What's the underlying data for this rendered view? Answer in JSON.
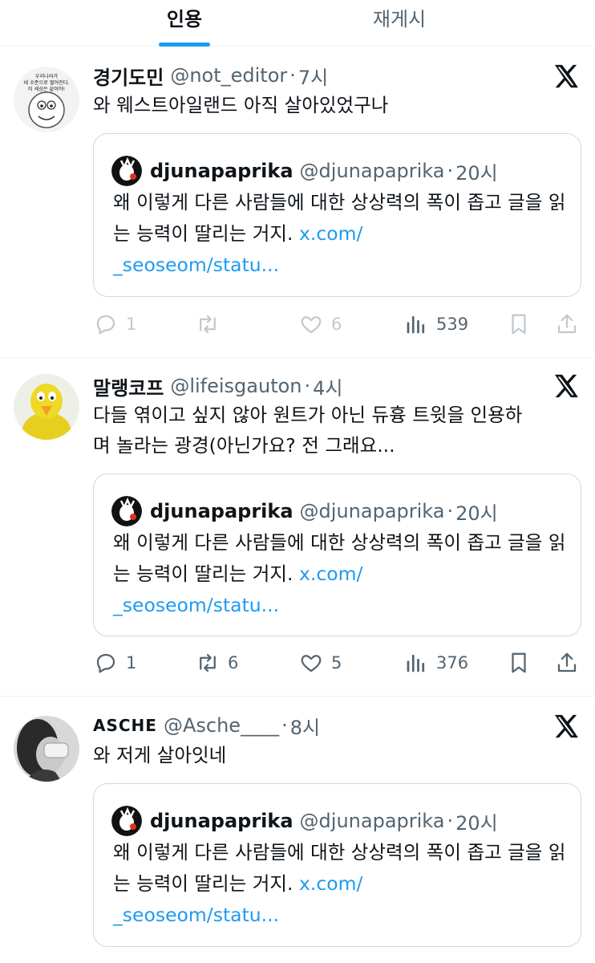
{
  "tabs": {
    "quote": "인용",
    "repost": "재게시"
  },
  "quoted_tweet": {
    "name": "djunapaprika",
    "handle": "@djunapaprika",
    "time": "20시",
    "text": "왜 이렇게 다른 사람들에 대한 상상력의 폭이 좁고 글을 읽는 능력이 딸리는 거지.",
    "link_line1": "x.com/",
    "link_line2": "_seoseom/statu..."
  },
  "tweets": [
    {
      "name": "경기도민",
      "handle": "@not_editor",
      "time": "7시",
      "text": "와 웨스트아일랜드 아직 살아있었구나",
      "replies": "1",
      "reposts": "",
      "likes": "6",
      "views": "539",
      "avatar_caption_line1": "우리나라가",
      "avatar_caption_line2": "네 수준으로 떨어진다.",
      "avatar_caption_line3": "이 세상은 끝이야!"
    },
    {
      "name": "말랭코프",
      "handle": "@lifeisgauton",
      "time": "4시",
      "text_line1": "다들 엮이고 싶지 않아 원트가 아닌 듀흉 트윗을 인용하",
      "text_line2": "며 놀라는 광경(아닌가요? 전 그래요...",
      "replies": "1",
      "reposts": "6",
      "likes": "5",
      "views": "376"
    },
    {
      "name": "ASCHE",
      "handle": "@Asche____",
      "time": "8시",
      "text": "와 저게 살아잇네"
    }
  ],
  "separator": "·",
  "colors": {
    "accent": "#1d9bf0",
    "muted": "#536471",
    "text": "#0f1419",
    "border": "#cfd9de"
  },
  "icons": [
    "x-logo-icon",
    "reply-icon",
    "repost-icon",
    "like-icon",
    "views-icon",
    "bookmark-icon",
    "share-icon"
  ]
}
